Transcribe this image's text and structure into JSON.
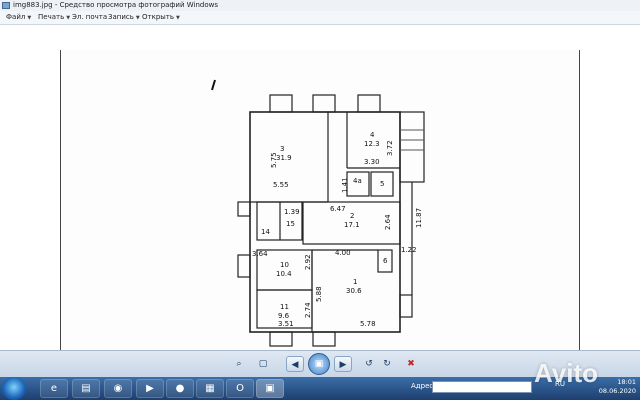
{
  "window": {
    "title": "img883.jpg - Средство просмотра фотографий Windows"
  },
  "menu": [
    {
      "label": "Файл"
    },
    {
      "label": "Печать"
    },
    {
      "label": "Эл. почта"
    },
    {
      "label": "Запись"
    },
    {
      "label": "Открыть"
    }
  ],
  "plan": {
    "rooms": [
      {
        "number": "3",
        "area": "31.9"
      },
      {
        "number": "4",
        "area": "12.3"
      },
      {
        "number": "4а",
        "area": ""
      },
      {
        "number": "5",
        "area": ""
      },
      {
        "number": "2",
        "area": "17.1"
      },
      {
        "number": "15",
        "area": ""
      },
      {
        "number": "14",
        "area": ""
      },
      {
        "number": "10",
        "area": "10.4"
      },
      {
        "number": "11",
        "area": "9.6"
      },
      {
        "number": "1",
        "area": "30.6"
      },
      {
        "number": "6",
        "area": ""
      }
    ],
    "dimensions": [
      "5.75",
      "5.55",
      "3.72",
      "3.30",
      "1.41",
      "6.47",
      "2.64",
      "11.87",
      "1.39",
      "4.00",
      "1.22",
      "3.64",
      "2.92",
      "5.88",
      "2.74",
      "3.51",
      "5.78"
    ]
  },
  "toolbar": {
    "zoom_icon": "magnifier-icon",
    "fit_icon": "fit-window-icon",
    "prev_icon": "previous-icon",
    "play_icon": "slideshow-icon",
    "next_icon": "next-icon",
    "rotate_left_icon": "rotate-left-icon",
    "rotate_right_icon": "rotate-right-icon",
    "delete_icon": "delete-icon"
  },
  "taskbar": {
    "address_label": "Адрес",
    "tray_lang": "RU",
    "clock_time": "18:01",
    "clock_date": "08.06.2020"
  },
  "watermark": "Avito",
  "colors": {
    "taskbar": "#1d3f6e",
    "toolbar": "#c7d5e6",
    "accent": "#3f7fc4"
  }
}
